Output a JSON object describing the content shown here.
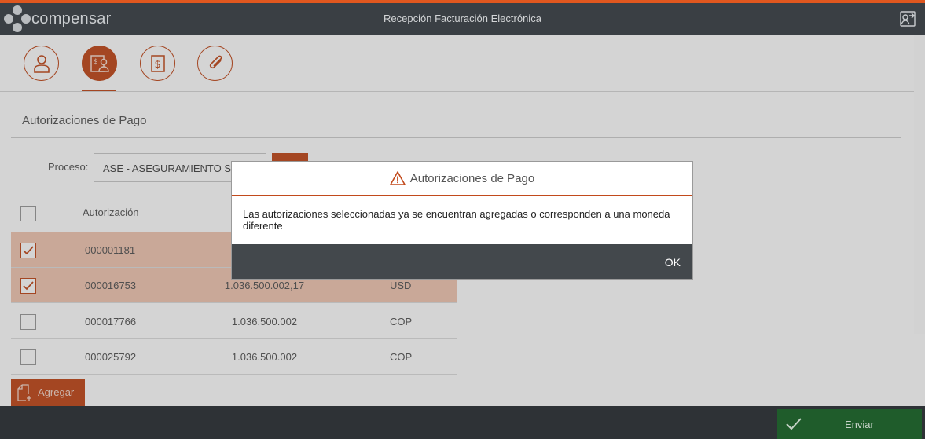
{
  "header": {
    "brand": "compensar",
    "title": "Recepción Facturación Electrónica",
    "logout_icon": "logout-icon"
  },
  "steps": [
    {
      "icon": "user-icon",
      "active": false
    },
    {
      "icon": "payment-authorization-icon",
      "active": true
    },
    {
      "icon": "dollar-document-icon",
      "active": false
    },
    {
      "icon": "paperclip-icon",
      "active": false
    }
  ],
  "section": {
    "title": "Autorizaciones de Pago"
  },
  "process": {
    "label": "Proceso:",
    "value": "ASE - ASEGURAMIENTO S"
  },
  "table": {
    "header": {
      "authorization": "Autorización"
    },
    "rows": [
      {
        "authorization": "000001181",
        "amount": "",
        "currency": "",
        "checked": true
      },
      {
        "authorization": "000016753",
        "amount": "1.036.500.002,17",
        "currency": "USD",
        "checked": true
      },
      {
        "authorization": "000017766",
        "amount": "1.036.500.002",
        "currency": "COP",
        "checked": false
      },
      {
        "authorization": "000025792",
        "amount": "1.036.500.002",
        "currency": "COP",
        "checked": false
      }
    ]
  },
  "add_button": {
    "label": "Agregar"
  },
  "send_button": {
    "label": "Enviar"
  },
  "modal": {
    "title": "Autorizaciones de Pago",
    "message": "Las autorizaciones seleccionadas ya se encuentran agregadas o corresponden a una moneda diferente",
    "ok_label": "OK"
  },
  "colors": {
    "accent": "#c24a1c",
    "header_bg": "#3a3f44",
    "selected_row": "#f1c7b3",
    "send_green": "#1f5c2b"
  }
}
